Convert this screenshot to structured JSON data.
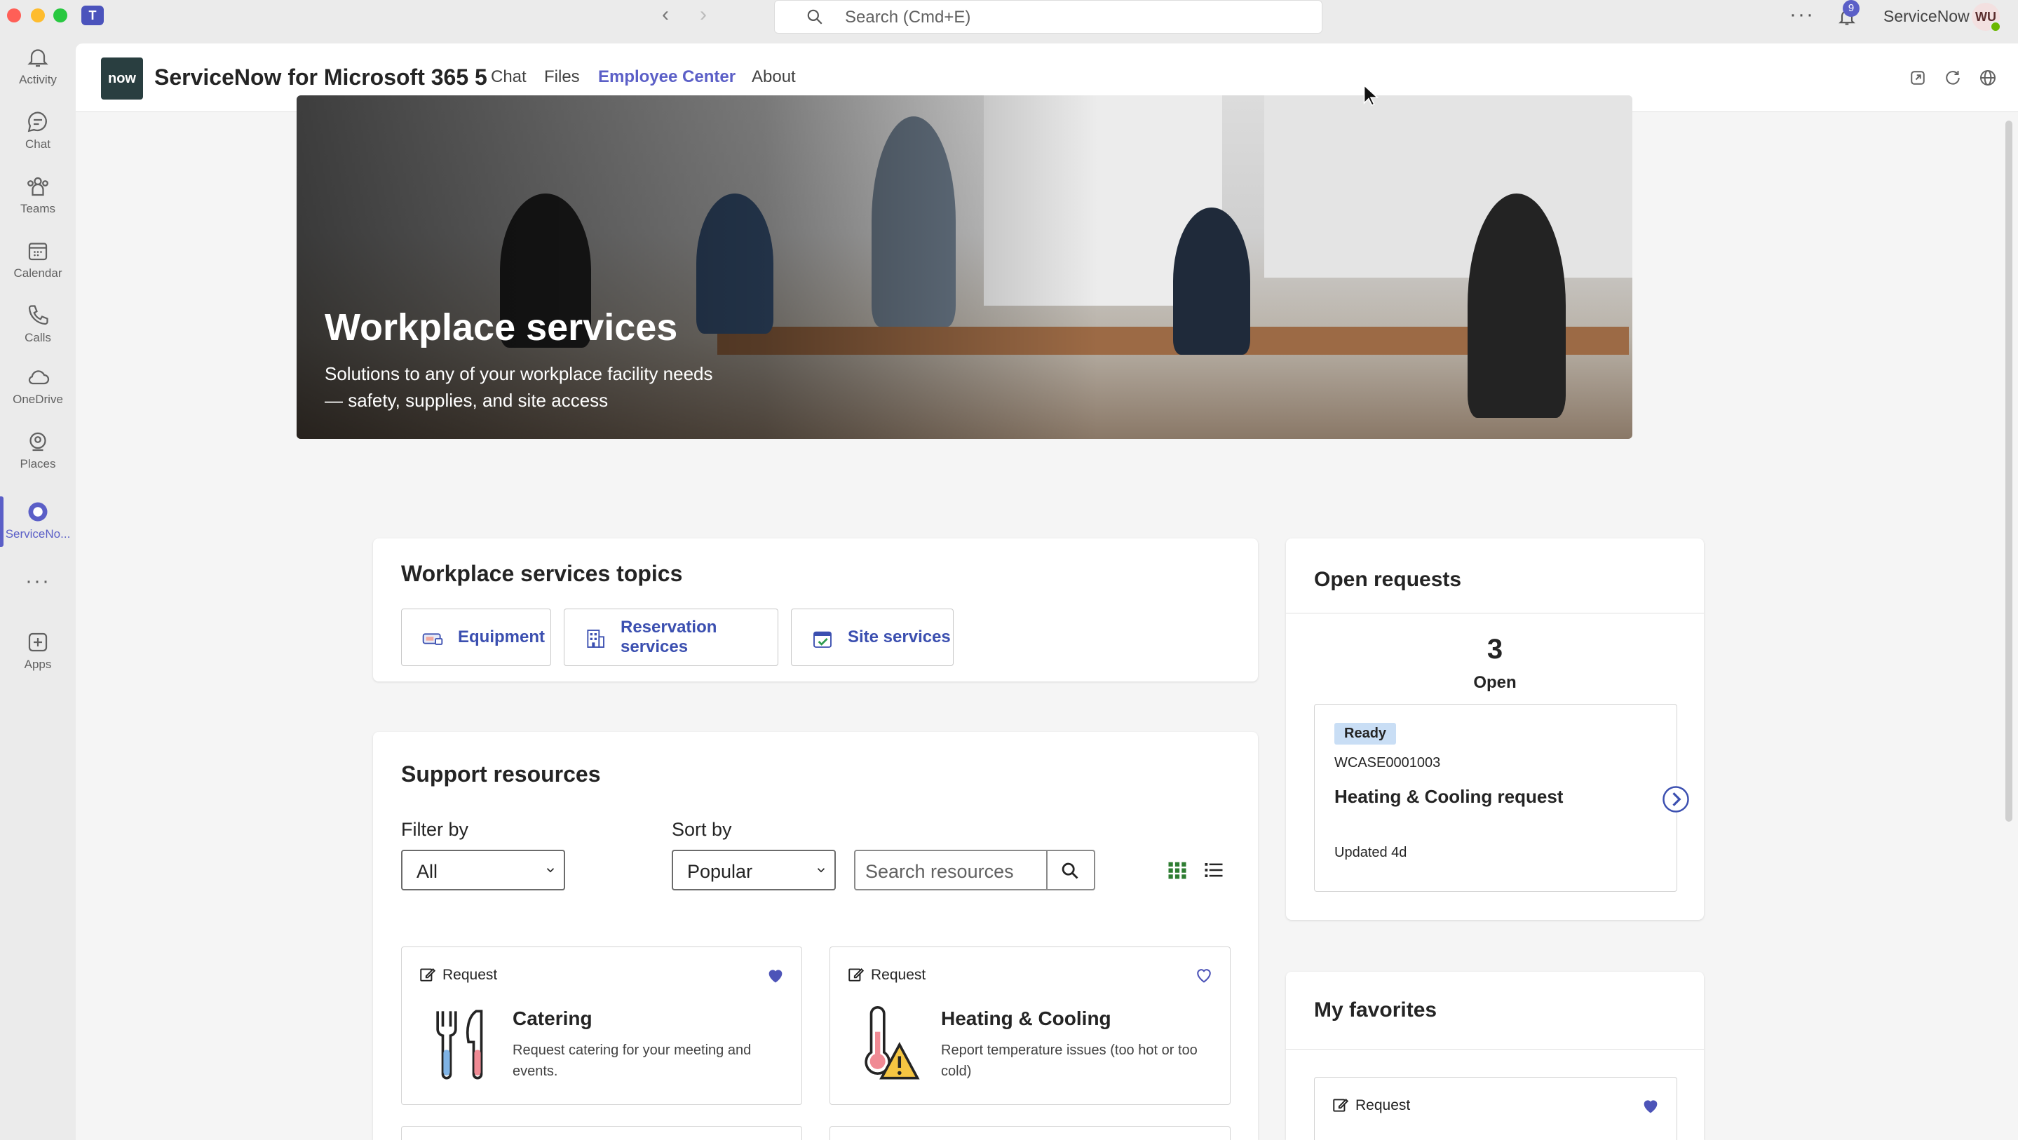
{
  "titlebar": {
    "search_placeholder": "Search (Cmd+E)",
    "notification_count": "9",
    "org_name": "ServiceNow",
    "user_initials": "WU",
    "teams_logo": "T"
  },
  "rail": {
    "items": [
      {
        "label": "Activity",
        "icon": "bell-icon"
      },
      {
        "label": "Chat",
        "icon": "chat-icon"
      },
      {
        "label": "Teams",
        "icon": "teams-icon"
      },
      {
        "label": "Calendar",
        "icon": "calendar-icon"
      },
      {
        "label": "Calls",
        "icon": "phone-icon"
      },
      {
        "label": "OneDrive",
        "icon": "cloud-icon"
      },
      {
        "label": "Places",
        "icon": "places-icon"
      },
      {
        "label": "ServiceNo...",
        "icon": "servicenow-icon"
      },
      {
        "label": "Apps",
        "icon": "add-app-icon"
      }
    ]
  },
  "app": {
    "logo_text": "now",
    "title": "ServiceNow for Microsoft 365 5",
    "tabs": [
      {
        "label": "Chat"
      },
      {
        "label": "Files"
      },
      {
        "label": "Employee Center"
      },
      {
        "label": "About"
      }
    ],
    "active_tab": "Employee Center"
  },
  "hero": {
    "title": "Workplace services",
    "subtitle": "Solutions to any of your workplace facility needs — safety, supplies, and site access"
  },
  "topics": {
    "heading": "Workplace services topics",
    "items": [
      {
        "label": "Equipment"
      },
      {
        "label": "Reservation services"
      },
      {
        "label": "Site services"
      }
    ]
  },
  "support": {
    "heading": "Support resources",
    "filter_label": "Filter by",
    "filter_value": "All",
    "sort_label": "Sort by",
    "sort_value": "Popular",
    "search_placeholder": "Search resources",
    "resources": [
      {
        "type": "Request",
        "title": "Catering",
        "description": "Request catering for your meeting and events.",
        "favorited": true
      },
      {
        "type": "Request",
        "title": "Heating & Cooling",
        "description": "Report temperature issues (too hot or too cold)",
        "favorited": false
      }
    ]
  },
  "open_requests": {
    "heading": "Open requests",
    "count": "3",
    "count_label": "Open",
    "request": {
      "status": "Ready",
      "number": "WCASE0001003",
      "title": "Heating & Cooling request",
      "updated": "Updated 4d"
    }
  },
  "favorites": {
    "heading": "My favorites",
    "items": [
      {
        "type": "Request",
        "favorited": true
      }
    ]
  },
  "colors": {
    "accent": "#5b5fc7",
    "topic_link": "#3b4fb0",
    "grid_view_icon": "#2e7d32",
    "ready_badge": "#c9def5"
  }
}
